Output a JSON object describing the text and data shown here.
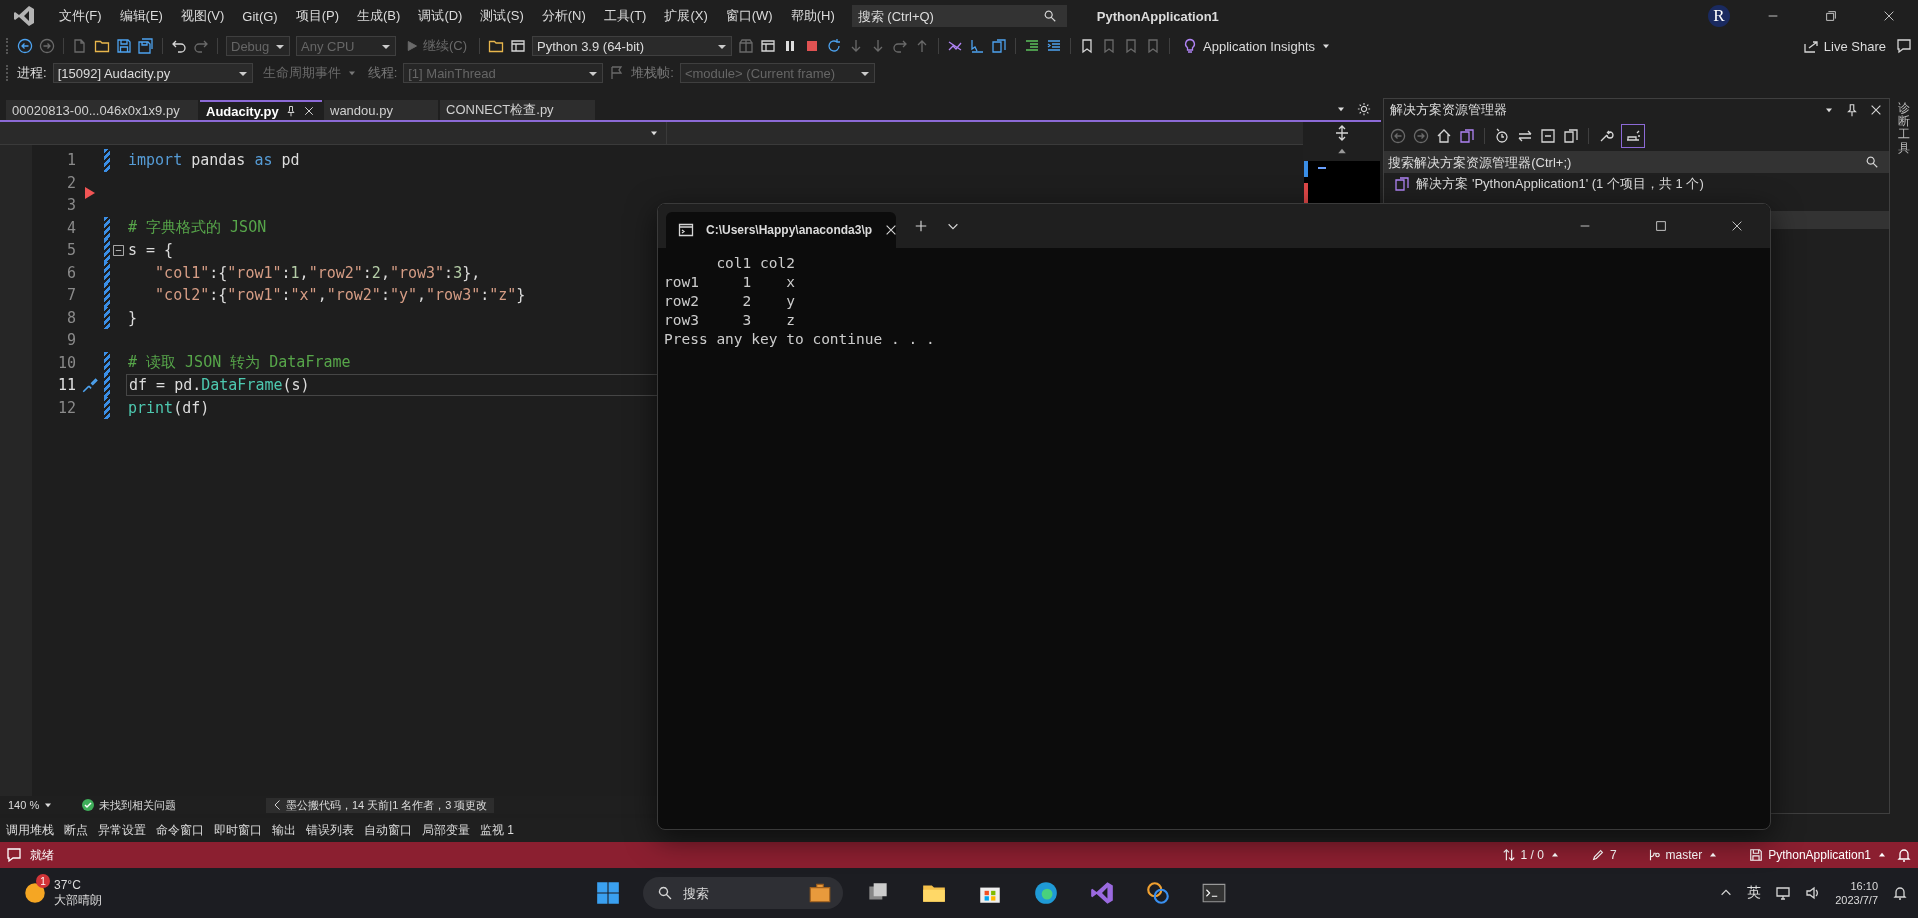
{
  "title_bar": {
    "menu": [
      "文件(F)",
      "编辑(E)",
      "视图(V)",
      "Git(G)",
      "项目(P)",
      "生成(B)",
      "调试(D)",
      "测试(S)",
      "分析(N)",
      "工具(T)",
      "扩展(X)",
      "窗口(W)",
      "帮助(H)"
    ],
    "search": {
      "placeholder": "搜索 (Ctrl+Q)"
    },
    "title": "PythonApplication1",
    "avatar": "R"
  },
  "toolbar": {
    "configuration": {
      "value": "Debug",
      "disabled": true
    },
    "platform": {
      "value": "Any CPU",
      "disabled": true
    },
    "continue": {
      "label": "继续(C)",
      "disabled": true
    },
    "environment": {
      "value": "Python 3.9 (64-bit)",
      "disabled": false
    },
    "insights": "Application Insights",
    "live_share": "Live Share"
  },
  "debug_bar": {
    "process_label": "进程:",
    "process": {
      "value": "[15092] Audacity.py",
      "disabled": false
    },
    "lifecycle": {
      "label": "生命周期事件",
      "disabled": true
    },
    "thread_label": "线程:",
    "thread": {
      "value": "[1] MainThread",
      "disabled": true
    },
    "stack_label": "堆栈帧:",
    "stack_frame": {
      "value": "<module> (Current frame)",
      "disabled": true
    }
  },
  "tabs": [
    {
      "label": "00020813-00...046x0x1x9.py",
      "selected": false
    },
    {
      "label": "Audacity.py",
      "selected": true
    },
    {
      "label": "wandou.py",
      "selected": false
    },
    {
      "label": "CONNECT检查.py",
      "selected": false
    }
  ],
  "editor": {
    "lines": [
      {
        "number": "1",
        "changed": true,
        "current": false,
        "tokens": [
          {
            "kind": "keyword",
            "text": "import"
          },
          {
            "kind": "plain",
            "text": " pandas "
          },
          {
            "kind": "keyword",
            "text": "as"
          },
          {
            "kind": "plain",
            "text": " pd"
          }
        ]
      },
      {
        "number": "2",
        "changed": false,
        "current": false
      },
      {
        "number": "3",
        "changed": false,
        "current": false
      },
      {
        "number": "4",
        "changed": true,
        "current": false,
        "tokens": [
          {
            "kind": "comment",
            "text": "# 字典格式的 JSON"
          }
        ]
      },
      {
        "number": "5",
        "changed": true,
        "current": false,
        "tokens": [
          {
            "kind": "plain",
            "text": "s = {"
          }
        ]
      },
      {
        "number": "6",
        "changed": true,
        "current": false,
        "tokens": [
          {
            "kind": "string",
            "text": "   \"col1\""
          },
          {
            "kind": "plain",
            "text": ":{"
          },
          {
            "kind": "string",
            "text": "\"row1\""
          },
          {
            "kind": "plain",
            "text": ":"
          },
          {
            "kind": "number",
            "text": "1"
          },
          {
            "kind": "plain",
            "text": ","
          },
          {
            "kind": "string",
            "text": "\"row2\""
          },
          {
            "kind": "plain",
            "text": ":"
          },
          {
            "kind": "number",
            "text": "2"
          },
          {
            "kind": "plain",
            "text": ","
          },
          {
            "kind": "string",
            "text": "\"row3\""
          },
          {
            "kind": "plain",
            "text": ":"
          },
          {
            "kind": "number",
            "text": "3"
          },
          {
            "kind": "plain",
            "text": "},"
          }
        ]
      },
      {
        "number": "7",
        "changed": true,
        "current": false,
        "tokens": [
          {
            "kind": "string",
            "text": "   \"col2\""
          },
          {
            "kind": "plain",
            "text": ":{"
          },
          {
            "kind": "string",
            "text": "\"row1\""
          },
          {
            "kind": "plain",
            "text": ":"
          },
          {
            "kind": "string",
            "text": "\"x\""
          },
          {
            "kind": "plain",
            "text": ","
          },
          {
            "kind": "string",
            "text": "\"row2\""
          },
          {
            "kind": "plain",
            "text": ":"
          },
          {
            "kind": "string",
            "text": "\"y\""
          },
          {
            "kind": "plain",
            "text": ","
          },
          {
            "kind": "string",
            "text": "\"row3\""
          },
          {
            "kind": "plain",
            "text": ":"
          },
          {
            "kind": "string",
            "text": "\"z\""
          },
          {
            "kind": "plain",
            "text": "}"
          }
        ]
      },
      {
        "number": "8",
        "changed": true,
        "current": false,
        "tokens": [
          {
            "kind": "plain",
            "text": "}"
          }
        ]
      },
      {
        "number": "9",
        "changed": false,
        "current": false
      },
      {
        "number": "10",
        "changed": true,
        "current": false,
        "tokens": [
          {
            "kind": "comment",
            "text": "# 读取 JSON 转为 DataFrame"
          }
        ]
      },
      {
        "number": "11",
        "changed": true,
        "current": true,
        "tokens": [
          {
            "kind": "plain",
            "text": "df = pd."
          },
          {
            "kind": "class",
            "text": "DataFrame"
          },
          {
            "kind": "plain",
            "text": "(s)"
          }
        ]
      },
      {
        "number": "12",
        "changed": true,
        "current": false,
        "tokens": [
          {
            "kind": "builtin",
            "text": "print"
          },
          {
            "kind": "plain",
            "text": "(df)"
          }
        ]
      }
    ],
    "zoom": "140 %",
    "issues": "未找到相关问题",
    "codelens": "墨公搬代码，14 天前|1 名作者，3 项更改"
  },
  "terminal": {
    "tab_title": "C:\\Users\\Happy\\anaconda3\\p",
    "output": [
      "      col1 col2",
      "row1     1    x",
      "row2     2    y",
      "row3     3    z",
      "Press any key to continue . . ."
    ]
  },
  "solution_explorer": {
    "title": "解决方案资源管理器",
    "search": {
      "placeholder": "搜索解决方案资源管理器(Ctrl+;)"
    },
    "items": [
      {
        "label": "解决方案 'PythonApplication1' (1 个项目，共 1 个)"
      }
    ]
  },
  "side_tab": "诊断工具",
  "tool_tabs": [
    "调用堆栈",
    "断点",
    "异常设置",
    "命令窗口",
    "即时窗口",
    "输出",
    "错误列表",
    "自动窗口",
    "局部变量",
    "监视 1"
  ],
  "status_bar": {
    "message": "就绪",
    "errors": "1 / 0",
    "edits": "7",
    "branch": "master",
    "project": "PythonApplication1"
  },
  "taskbar": {
    "weather": {
      "temperature": "37°C",
      "condition": "大部晴朗",
      "badge": "1"
    },
    "search": {
      "placeholder": "搜索"
    },
    "ime": "英",
    "time": "16:10",
    "date": "2023/7/7"
  }
}
